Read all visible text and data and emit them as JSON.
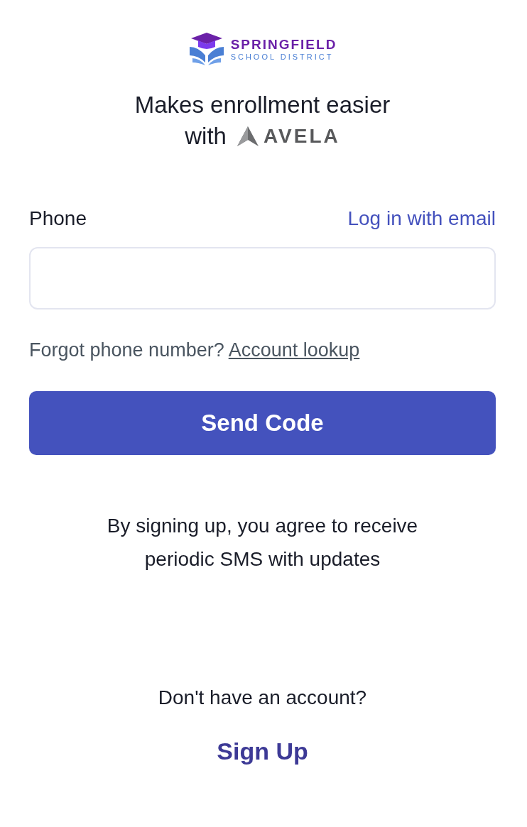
{
  "logo": {
    "name": "SPRINGFIELD",
    "subtitle": "SCHOOL DISTRICT"
  },
  "tagline": {
    "line_1": "Makes enrollment easier",
    "line_2": "with",
    "partner": "AVELA"
  },
  "phone_field": {
    "label": "Phone",
    "alt_login": "Log in with email"
  },
  "forgot": {
    "text": "Forgot phone number?",
    "link": "Account lookup"
  },
  "submit": "Send Code",
  "notice": "By signing up, you agree to receive periodic SMS with updates",
  "signup": {
    "prompt": "Don't have an account?",
    "link": "Sign Up"
  }
}
